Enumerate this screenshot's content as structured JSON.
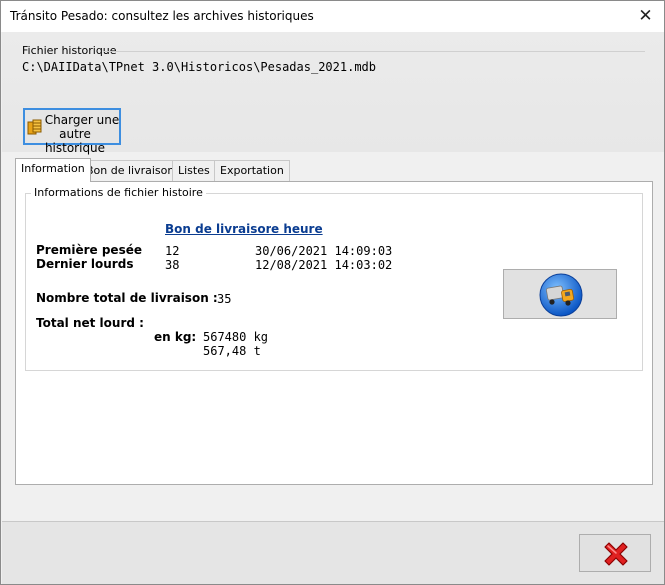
{
  "window": {
    "title": "Tránsito Pesado: consultez les archives historiques",
    "close_glyph": "✕"
  },
  "history_file": {
    "legend": "Fichier historique",
    "path": "C:\\DAIIData\\TPnet 3.0\\Historicos\\Pesadas_2021.mdb",
    "load_button": {
      "line1": "Charger une",
      "line2": "autre historique"
    }
  },
  "tabs": [
    {
      "label": "Information",
      "active": true
    },
    {
      "label": "Bon de livraisons",
      "active": false
    },
    {
      "label": "Listes",
      "active": false
    },
    {
      "label": "Exportation",
      "active": false
    }
  ],
  "info": {
    "group_legend": "Informations de fichier histoire",
    "link_part1": "Bon de livraison",
    "link_part2": "e heure",
    "first_label": "Première pesée",
    "first_number": "12",
    "first_datetime": "30/06/2021 14:09:03",
    "last_label": "Dernier lourds",
    "last_number": "38",
    "last_datetime": "12/08/2021 14:03:02",
    "total_deliveries_label": "Nombre total de livraison :",
    "total_deliveries_value": "35",
    "total_net_label": "Total net lourd :",
    "kg_label": "en kg:",
    "kg_value": "567480 kg",
    "t_value": "567,48 t"
  },
  "icons": {
    "load": "database-icon",
    "truck": "truck-icon",
    "exit": "red-x-icon"
  }
}
